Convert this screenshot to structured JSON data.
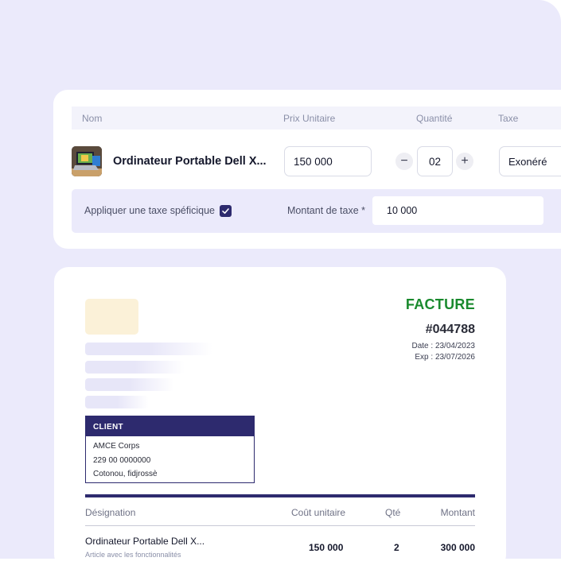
{
  "table_header": {
    "name": "Nom",
    "unit_price": "Prix Unitaire",
    "quantity": "Quantité",
    "tax": "Taxe"
  },
  "product_row": {
    "name": "Ordinateur Portable Dell X...",
    "unit_price": "150 000",
    "quantity": "02",
    "decrement": "−",
    "increment": "+",
    "tax": "Exonéré"
  },
  "tax_row": {
    "apply_label": "Appliquer une taxe spéficique",
    "apply_checked": true,
    "amount_label": "Montant de taxe *",
    "amount_value": "10 000"
  },
  "invoice": {
    "title": "FACTURE",
    "number": "#044788",
    "date_label": "Date :",
    "date_value": "23/04/2023",
    "exp_label": "Exp :",
    "exp_value": "23/07/2026",
    "client": {
      "header": "CLIENT",
      "name": "AMCE Corps",
      "phone": "229 00 0000000",
      "address": "Cotonou, fidjrossè"
    },
    "table": {
      "designation": "Désignation",
      "unit_cost": "Coût unitaire",
      "qty": "Qté",
      "amount": "Montant"
    },
    "item": {
      "name": "Ordinateur Portable Dell X...",
      "description": "Article avec les fonctionnalités",
      "unit_cost": "150 000",
      "qty": "2",
      "amount": "300 000"
    }
  },
  "colors": {
    "background": "#ebeafb",
    "accent": "#2d2a6e",
    "facture_green": "#1a8a2e"
  }
}
